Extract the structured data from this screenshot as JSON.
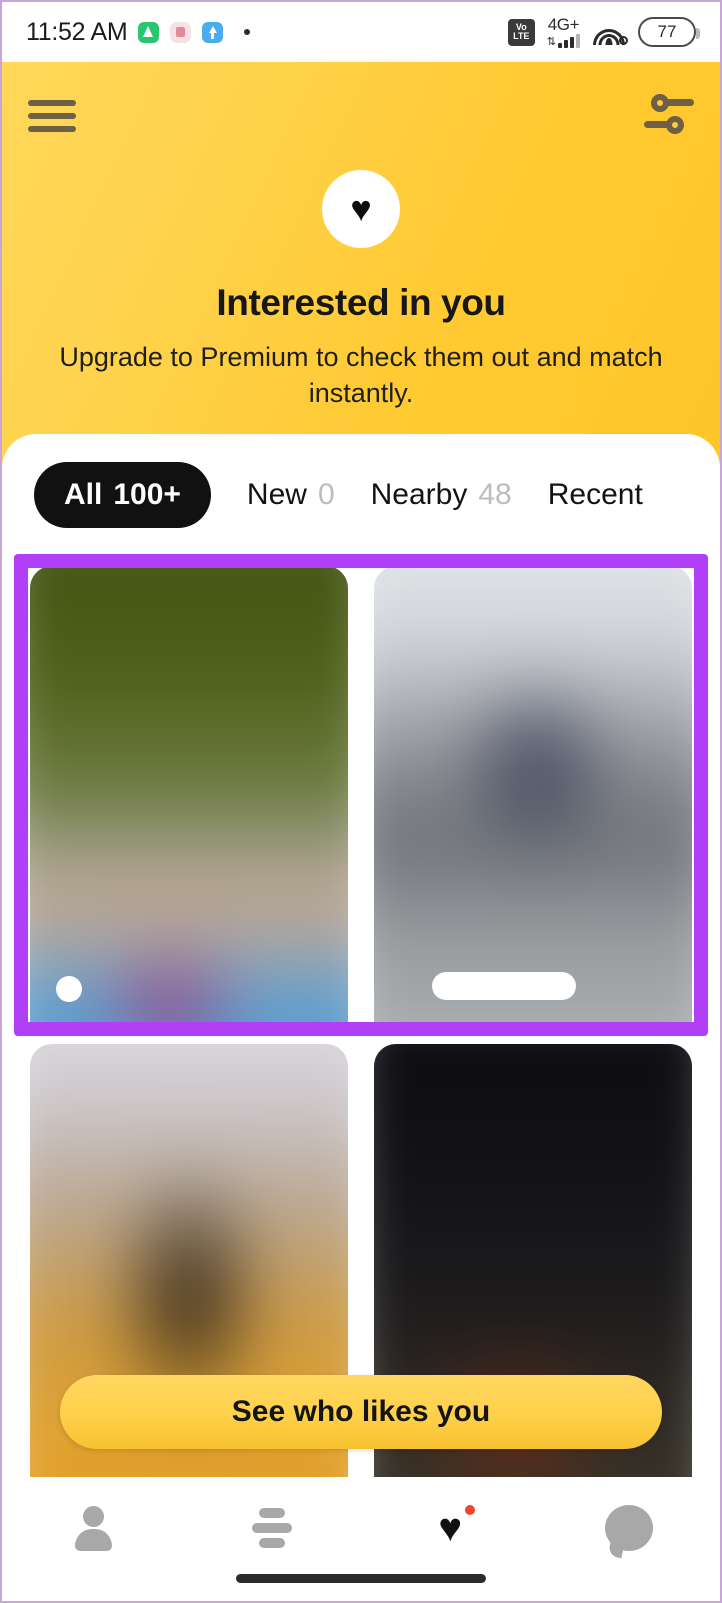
{
  "status_bar": {
    "time": "11:52 AM",
    "app_icons": [
      "whatsapp-icon",
      "photos-icon",
      "telegram-icon",
      "dot-indicator"
    ],
    "network_label": "4G+",
    "volte_line1": "Vo",
    "volte_line2": "LTE",
    "battery_percent": "77",
    "icons_right": [
      "volte-icon",
      "signal-icon",
      "wifi-icon",
      "battery-icon"
    ]
  },
  "header": {
    "menu_icon": "hamburger-menu-icon",
    "filter_icon": "filter-sliders-icon",
    "logo_icon": "heart-logo-icon",
    "logo_glyph": "♥",
    "title": "Interested in you",
    "subtitle": "Upgrade to Premium to check them out and match instantly.",
    "background_color": "#FFCE37"
  },
  "tabs": [
    {
      "label": "All",
      "count": "100+",
      "active": true
    },
    {
      "label": "New",
      "count": "0",
      "active": false
    },
    {
      "label": "Nearby",
      "count": "48",
      "active": false
    },
    {
      "label": "Recent",
      "count": "",
      "active": false
    }
  ],
  "grid": {
    "highlight_color": "#B03FF7",
    "cards": [
      {
        "name": "profile-card-1",
        "blurred": true,
        "badge": "online-dot"
      },
      {
        "name": "profile-card-2",
        "blurred": true,
        "badge": "name-pill"
      },
      {
        "name": "profile-card-3",
        "blurred": true,
        "badge": ""
      },
      {
        "name": "profile-card-4",
        "blurred": true,
        "badge": ""
      }
    ]
  },
  "cta": {
    "label": "See who likes you",
    "color": "#FFD04A"
  },
  "bottom_nav": {
    "items": [
      {
        "name": "nav-profile",
        "icon": "person-icon",
        "active": false,
        "badge": false
      },
      {
        "name": "nav-discover",
        "icon": "stacked-cards-icon",
        "active": false,
        "badge": false
      },
      {
        "name": "nav-likes",
        "icon": "heart-icon",
        "active": true,
        "badge": true
      },
      {
        "name": "nav-messages",
        "icon": "chat-bubble-icon",
        "active": false,
        "badge": false
      }
    ],
    "heart_glyph": "♥"
  },
  "gesture_bar": "home-indicator"
}
